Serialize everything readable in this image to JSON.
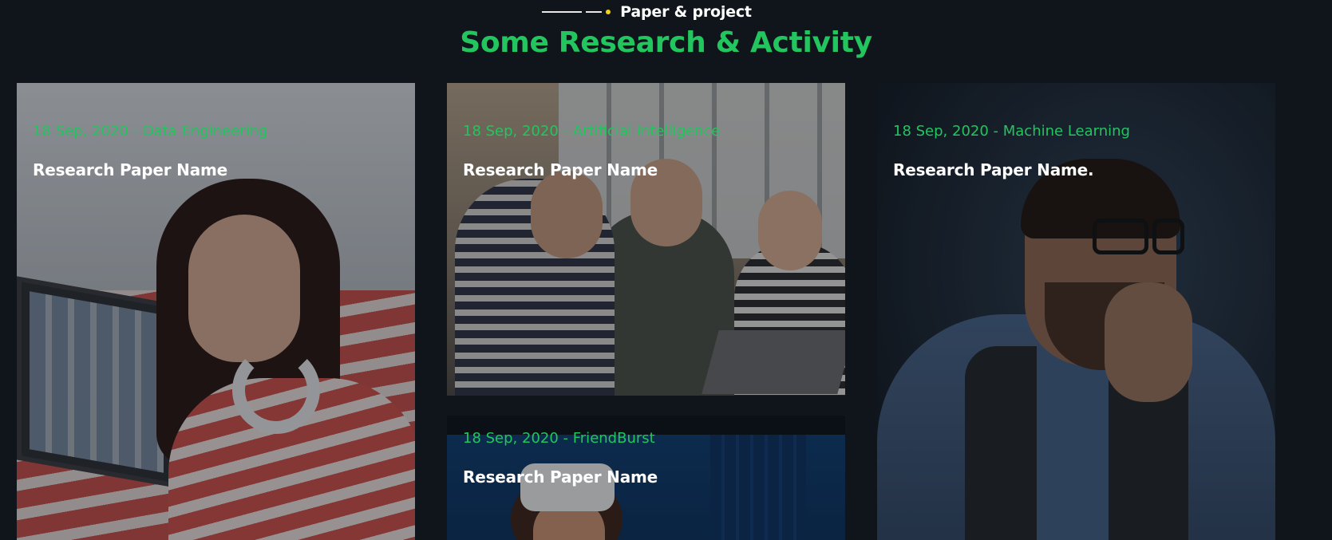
{
  "header": {
    "eyebrow": "Paper & project",
    "title": "Some Research & Activity"
  },
  "cards": [
    {
      "meta": "18 Sep, 2020 - Data Engineering",
      "name": "Research Paper Name"
    },
    {
      "meta": "18 Sep, 2020 - Artificial Intelligence",
      "name": "Research Paper Name"
    },
    {
      "meta": "18 Sep, 2020 - Machine Learning",
      "name": "Research Paper Name."
    },
    {
      "meta": "18 Sep, 2020 - FriendBurst",
      "name": "Research Paper Name"
    }
  ],
  "colors": {
    "background": "#0f151b",
    "accent": "#22c55e",
    "dot": "#f3d21b"
  }
}
